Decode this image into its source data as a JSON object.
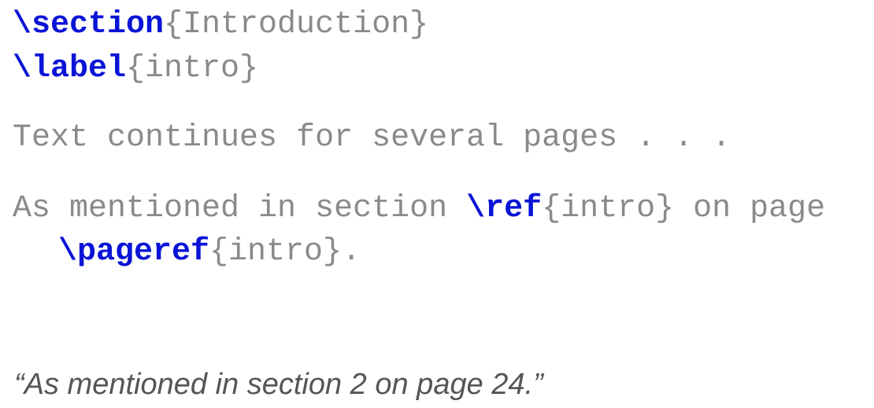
{
  "code": {
    "line1": {
      "cmd": "\\section",
      "arg": "{Introduction}"
    },
    "line2": {
      "cmd": "\\label",
      "arg": "{intro}"
    },
    "line3": {
      "text": "Text continues for several pages . . ."
    },
    "line4": {
      "before": "As mentioned in section ",
      "cmd": "\\ref",
      "arg": "{intro}",
      "after": " on page"
    },
    "line5": {
      "cmd": "\\pageref",
      "arg": "{intro}",
      "after": "."
    }
  },
  "output": {
    "text": "“As mentioned in section 2 on page 24.”"
  },
  "colors": {
    "command": "#0a14d6",
    "text": "#8a8a8a",
    "output": "#555555"
  }
}
